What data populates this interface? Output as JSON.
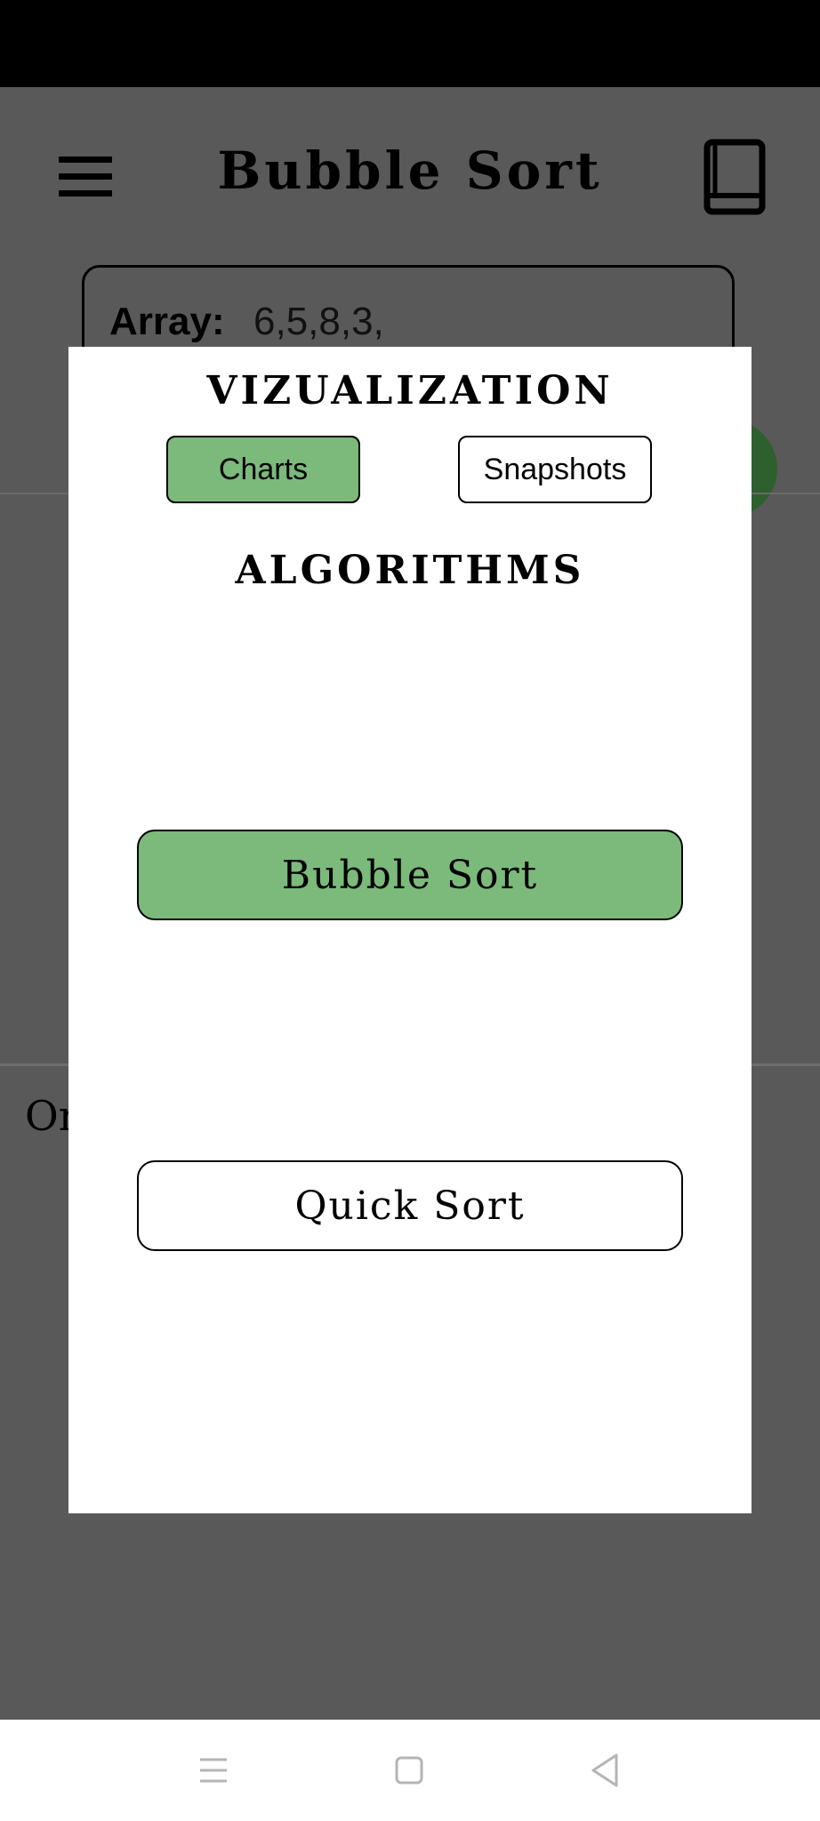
{
  "header": {
    "title": "Bubble Sort"
  },
  "array": {
    "label": "Array:",
    "value": "6,5,8,3,"
  },
  "background": {
    "partial_text": "Or"
  },
  "modal": {
    "visualization_title": "VIZUALIZATION",
    "visualization_options": [
      "Charts",
      "Snapshots"
    ],
    "selected_visualization": "Charts",
    "algorithms_title": "ALGORITHMS",
    "algorithms": [
      "Bubble Sort",
      "Quick Sort"
    ],
    "selected_algorithm": "Bubble Sort"
  },
  "colors": {
    "accent": "#7bba7b",
    "overlay": "#595959",
    "fab": "#2e5f2e"
  },
  "icons": {
    "menu": "hamburger-menu-icon",
    "book": "book-icon",
    "recent": "recent-apps-icon",
    "home": "home-icon",
    "back": "back-icon"
  }
}
